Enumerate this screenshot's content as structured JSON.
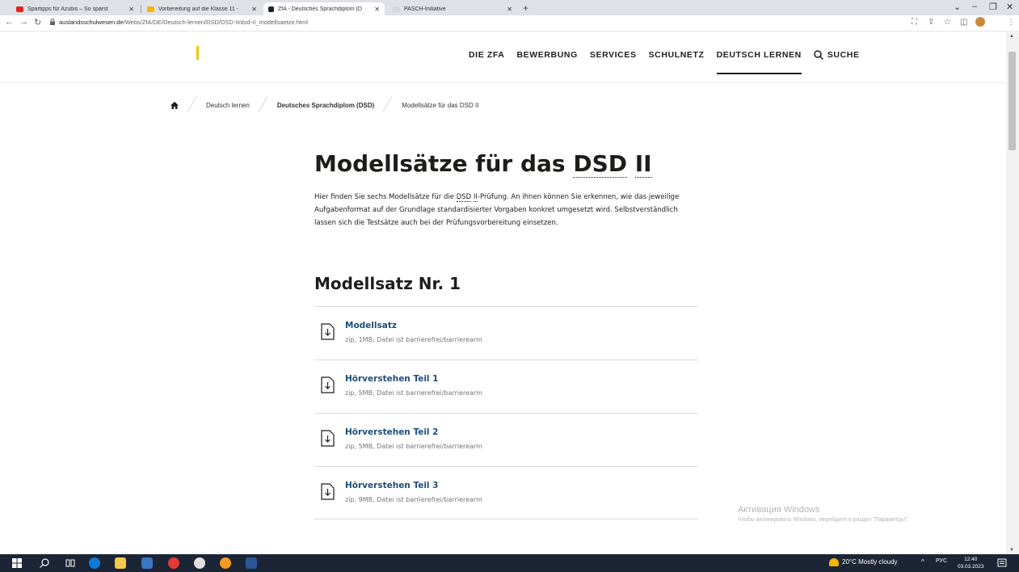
{
  "browser": {
    "tabs": [
      {
        "title": "Spartipps für Azubis – So sparst",
        "active": false
      },
      {
        "title": "Vorbereitung auf die Klasse 11 -",
        "active": false
      },
      {
        "title": "ZfA - Deutsches Sprachdiplom (D",
        "active": true
      },
      {
        "title": "PASCH-Initiative",
        "active": false
      }
    ],
    "new_tab": "+",
    "url_host": "auslandsschulwesen.de",
    "url_path": "/Webs/ZfA/DE/Deutsch-lernen/DSD/DSD-II/dsd-II_modellsaetze.html"
  },
  "header": {
    "nav": [
      "DIE ZFA",
      "BEWERBUNG",
      "SERVICES",
      "SCHULNETZ",
      "DEUTSCH LERNEN"
    ],
    "active_nav": "DEUTSCH LERNEN",
    "search_label": "SUCHE"
  },
  "breadcrumb": [
    "Deutsch lernen",
    "Deutsches Sprachdiplom (DSD)",
    "Modellsätze für das DSD II"
  ],
  "main": {
    "title_prefix": "Modellsätze für das ",
    "title_abbr1": "DSD",
    "title_abbr2": "II",
    "intro_a": "Hier finden Sie sechs Modellsätze für die ",
    "intro_abbr1": "DSD",
    "intro_abbr2": "II",
    "intro_b": "-Prüfung. An ihnen können Sie erkennen, wie das jeweilige Aufgabenformat auf der Grundlage standardisierter Vorgaben konkret umgesetzt wird. Selbstverständlich lassen sich die Testsätze auch bei der Prüfungsvorbereitung einsetzen.",
    "section_title": "Modellsatz Nr. 1",
    "downloads": [
      {
        "title": "Modellsatz",
        "meta": "zip, 1MB, Datei ist barrierefrei/barrierearm"
      },
      {
        "title": "Hörverstehen Teil 1",
        "meta": "zip, 5MB, Datei ist barrierefrei/barrierearm"
      },
      {
        "title": "Hörverstehen Teil 2",
        "meta": "zip, 5MB, Datei ist barrierefrei/barrierearm"
      },
      {
        "title": "Hörverstehen Teil 3",
        "meta": "zip, 9MB, Datei ist barrierefrei/barrierearm"
      }
    ]
  },
  "watermark": {
    "line1": "Активация Windows",
    "line2": "Чтобы активировать Windows, перейдите в раздел \"Параметры\"."
  },
  "taskbar": {
    "weather": "20°C  Mostly cloudy",
    "lang": "РУС",
    "time": "12:40",
    "date": "03.03.2023"
  },
  "colors": {
    "accent": "#f3c400",
    "link": "#1f4e79",
    "taskbar": "#1c2536"
  }
}
